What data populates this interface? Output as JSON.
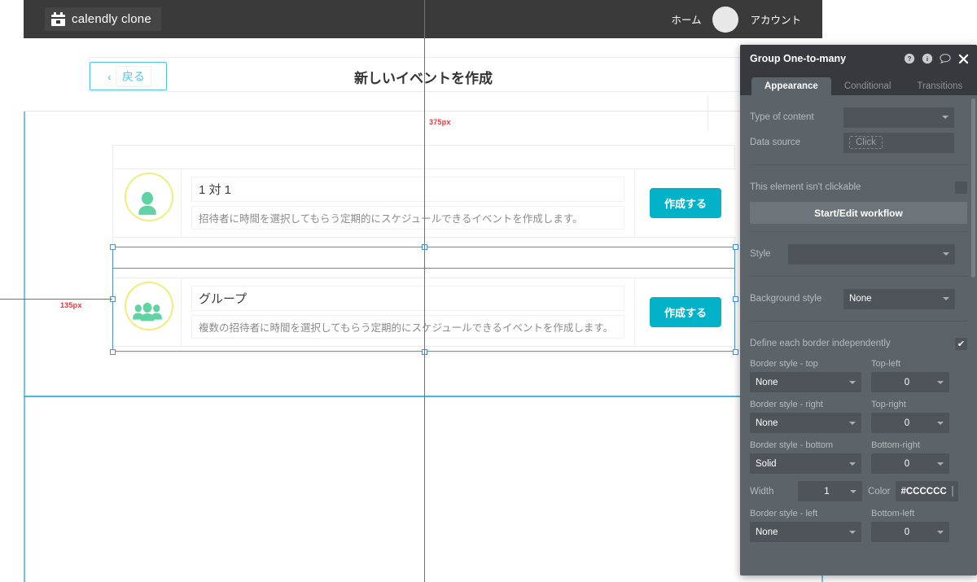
{
  "appbar": {
    "brand_label": "calendly clone",
    "brand_icon": "calendar-icon",
    "nav_home": "ホーム",
    "nav_account": "アカウント",
    "avatar_icon": "avatar-placeholder",
    "bg_color": "#3a3a3a"
  },
  "page": {
    "back_chevron": "‹",
    "back_label": "戻る",
    "title": "新しいイベントを作成",
    "accent_color": "#4fc3e8"
  },
  "guides": {
    "width_label": "375px",
    "height_label": "135px",
    "guide_color": "#ff3b30",
    "canvas_guide_color": "#6ec6ea",
    "selection_color": "#4a90e2"
  },
  "cards": [
    {
      "icon": "single-person-icon",
      "title": "1 対 1",
      "description": "招待者に時間を選択してもらう定期的にスケジュールできるイベントを作成します。",
      "button_label": "作成する"
    },
    {
      "icon": "group-people-icon",
      "title": "グループ",
      "description": "複数の招待者に時間を選択してもらう定期的にスケジュールできるイベントを作成します。",
      "button_label": "作成する"
    }
  ],
  "card_style": {
    "button_color": "#01b2c8",
    "icon_color": "#5fd3a4",
    "ring_color": "#eeee7e"
  },
  "panel": {
    "title": "Group One-to-many",
    "icons": [
      "help-icon",
      "info-icon",
      "comment-icon",
      "close-icon"
    ],
    "tabs": [
      {
        "label": "Appearance",
        "active": true
      },
      {
        "label": "Conditional",
        "active": false
      },
      {
        "label": "Transitions",
        "active": false
      }
    ],
    "fields": {
      "type_of_content_label": "Type of content",
      "type_of_content_value": "",
      "data_source_label": "Data source",
      "data_source_placeholder": "Click",
      "not_clickable_label": "This element isn't clickable",
      "not_clickable_checked": false,
      "workflow_button": "Start/Edit workflow",
      "style_label": "Style",
      "style_value": "",
      "background_style_label": "Background style",
      "background_style_value": "None",
      "define_borders_label": "Define each border independently",
      "define_borders_checked": true,
      "border_top_label": "Border style - top",
      "border_top_value": "None",
      "top_left_label": "Top-left",
      "top_left_value": "0",
      "border_right_label": "Border style - right",
      "border_right_value": "None",
      "top_right_label": "Top-right",
      "top_right_value": "0",
      "border_bottom_label": "Border style - bottom",
      "border_bottom_value": "Solid",
      "bottom_right_label": "Bottom-right",
      "bottom_right_value": "0",
      "width_label": "Width",
      "width_value": "1",
      "color_label": "Color",
      "color_value": "#CCCCCC",
      "color_swatch": "#CCCCCC",
      "border_left_label": "Border style - left",
      "border_left_value": "None",
      "bottom_left_label": "Bottom-left",
      "bottom_left_value": "0"
    }
  }
}
